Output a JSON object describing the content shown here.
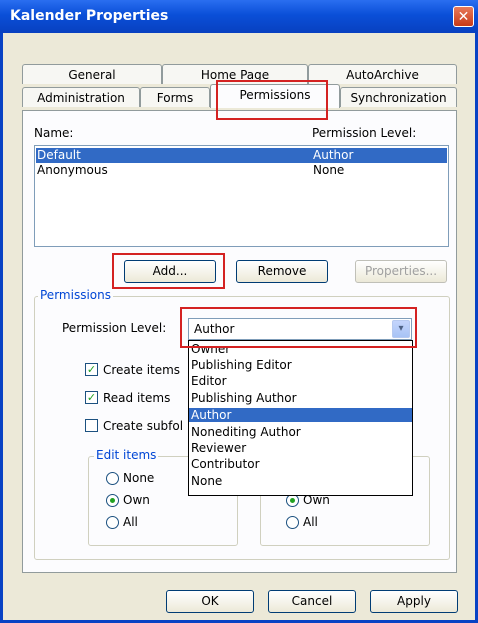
{
  "window": {
    "title": "Kalender Properties",
    "close_glyph": "✕"
  },
  "tabs_top": [
    "General",
    "Home Page",
    "AutoArchive"
  ],
  "tabs_bottom": [
    "Administration",
    "Forms",
    "Permissions",
    "Synchronization"
  ],
  "active_tab": "Permissions",
  "list": {
    "header_name": "Name:",
    "header_level": "Permission Level:",
    "rows": [
      {
        "name": "Default",
        "level": "Author",
        "selected": true
      },
      {
        "name": "Anonymous",
        "level": "None",
        "selected": false
      }
    ]
  },
  "buttons": {
    "add": "Add...",
    "remove": "Remove",
    "properties": "Properties..."
  },
  "permissions": {
    "group_label": "Permissions",
    "level_label": "Permission Level:",
    "level_value": "Author",
    "dropdown_arrow": "▾",
    "options": [
      "Owner",
      "Publishing Editor",
      "Editor",
      "Publishing Author",
      "Author",
      "Nonediting Author",
      "Reviewer",
      "Contributor",
      "None"
    ],
    "selected_option": "Author",
    "checkboxes": [
      {
        "label": "Create items",
        "checked": true
      },
      {
        "label": "Read items",
        "checked": true
      },
      {
        "label": "Create subfol",
        "checked": false
      }
    ],
    "check_glyph": "✓",
    "edit_items": {
      "label": "Edit items",
      "options": [
        "None",
        "Own",
        "All"
      ],
      "selected": "Own"
    },
    "delete_items": {
      "options": [
        "Own",
        "All"
      ],
      "selected": "Own"
    }
  },
  "footer": {
    "ok": "OK",
    "cancel": "Cancel",
    "apply": "Apply"
  }
}
